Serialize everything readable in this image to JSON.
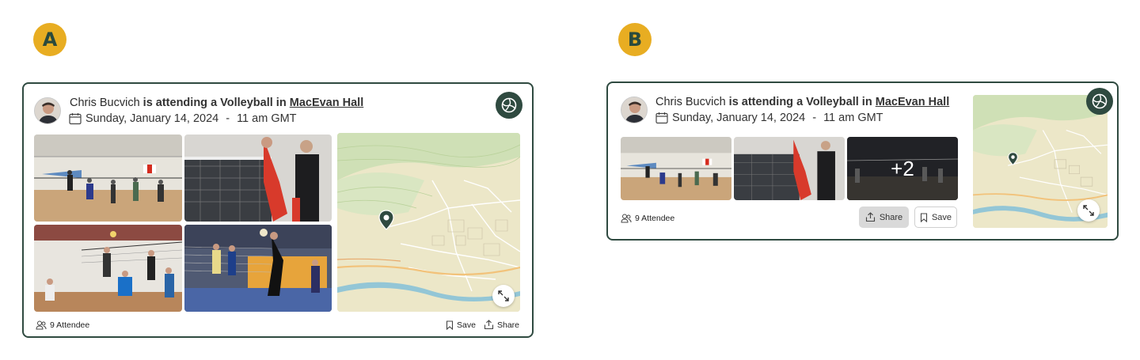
{
  "variants": [
    {
      "label": "A"
    },
    {
      "label": "B"
    }
  ],
  "post": {
    "user_name": "Chris Bucvich",
    "action_text": "is attending a Volleyball in",
    "venue": "MacEvan Hall",
    "date": "Sunday, January 14, 2024",
    "separator": "-",
    "time": "11 am GMT",
    "attendees": "9 Attendee",
    "save_label": "Save",
    "share_label": "Share",
    "more_photos": "+2"
  },
  "icons": {
    "sport": "volleyball-icon",
    "calendar": "calendar-icon",
    "attendees": "people-icon",
    "save": "bookmark-icon",
    "share": "share-icon",
    "expand": "expand-icon",
    "map_pin": "map-pin-icon"
  },
  "colors": {
    "badge": "#e8ad22",
    "brand_dark": "#2f4a40",
    "card_border": "#2f4a40"
  }
}
